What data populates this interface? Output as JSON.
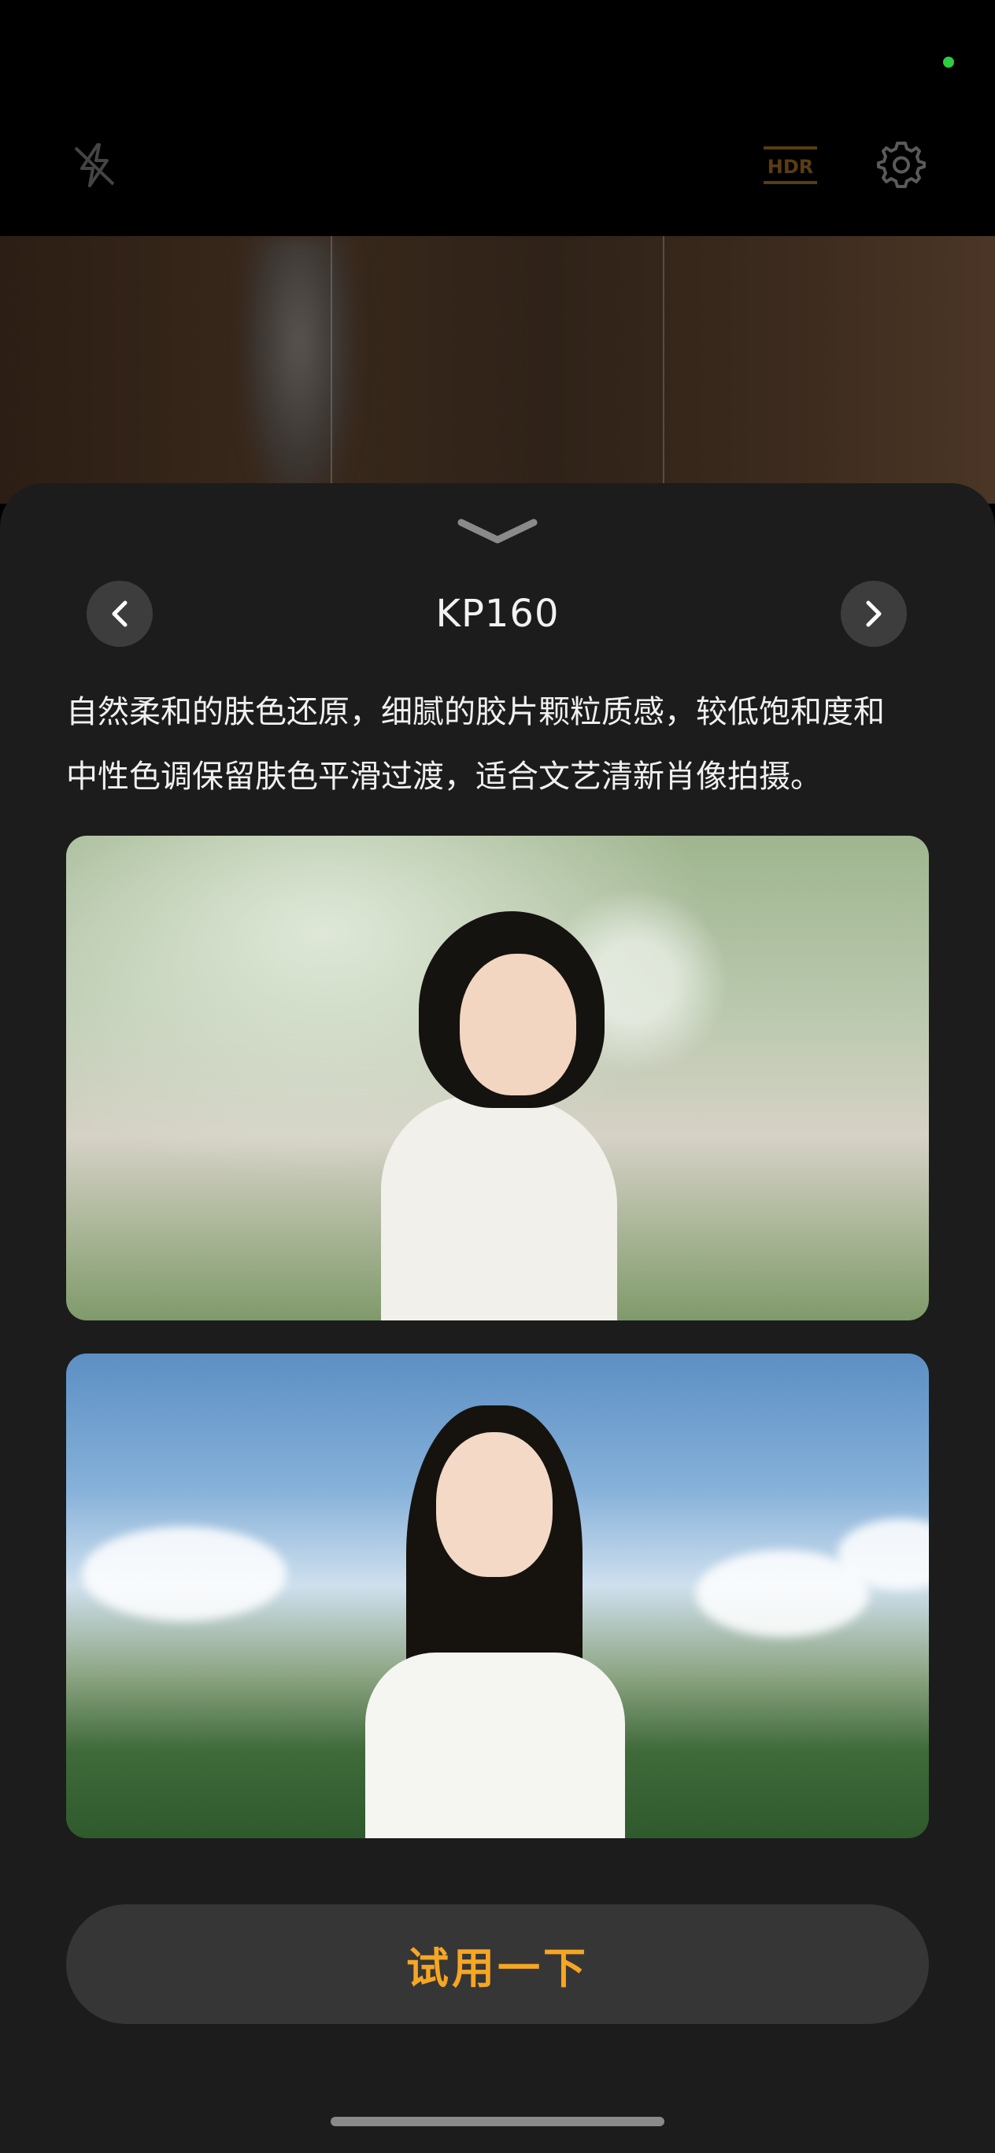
{
  "camera": {
    "hdr_label": "HDR",
    "accent_color": "#f5a623",
    "status_dot_color": "#2ecc40"
  },
  "filter_sheet": {
    "title": "KP160",
    "description_line1": "自然柔和的肤色还原，细腻的胶片颗粒质感，较低饱和度和",
    "description_line2": "中性色调保留肤色平滑过渡，适合文艺清新肖像拍摄。",
    "try_button_label": "试用一下"
  },
  "icons": {
    "flash": "flash-off-icon",
    "hdr": "hdr-icon",
    "settings": "gear-icon",
    "collapse": "chevron-down-icon",
    "prev": "chevron-left-icon",
    "next": "chevron-right-icon"
  }
}
